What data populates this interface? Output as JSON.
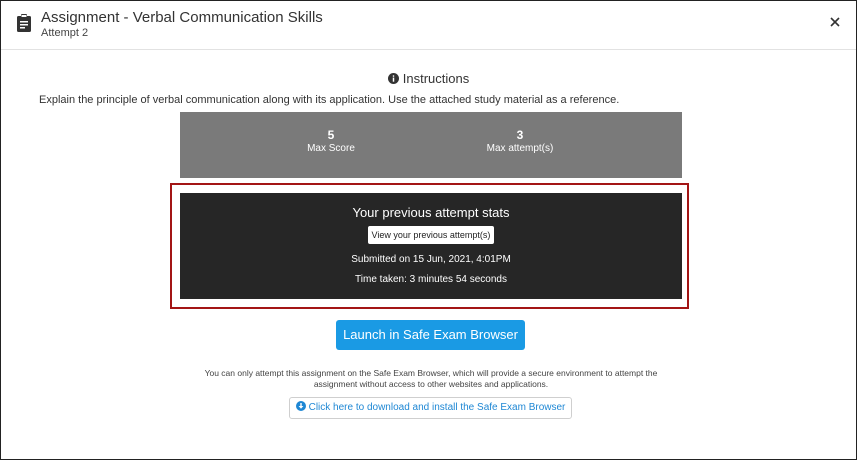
{
  "header": {
    "title": "Assignment - Verbal Communication Skills",
    "subtitle": "Attempt 2",
    "icon": "clipboard-icon",
    "close_icon": "close-icon"
  },
  "instructions": {
    "heading": "Instructions",
    "icon": "info-icon",
    "description": "Explain the principle of verbal communication along with its application. Use the attached study material as a reference."
  },
  "stats": {
    "max_score_value": "5",
    "max_score_label": "Max Score",
    "max_attempts_value": "3",
    "max_attempts_label": "Max attempt(s)"
  },
  "previous_attempt": {
    "title": "Your previous attempt stats",
    "view_button_label": "View your previous attempt(s)",
    "submitted": "Submitted on 15 Jun, 2021, 4:01PM",
    "time_taken": "Time taken: 3 minutes 54 seconds"
  },
  "launch": {
    "button_label": "Launch in Safe Exam Browser",
    "notice": "You can only attempt this assignment on the Safe Exam Browser, which will provide a secure environment to attempt the assignment without access to other websites and applications.",
    "download_label": "Click here to download and install the Safe Exam Browser",
    "download_icon": "download-icon"
  },
  "colors": {
    "accent": "#1a9ae4",
    "stats_bg": "#7a7a7a",
    "dark_bg": "#262626",
    "highlight_border": "#a31515"
  }
}
